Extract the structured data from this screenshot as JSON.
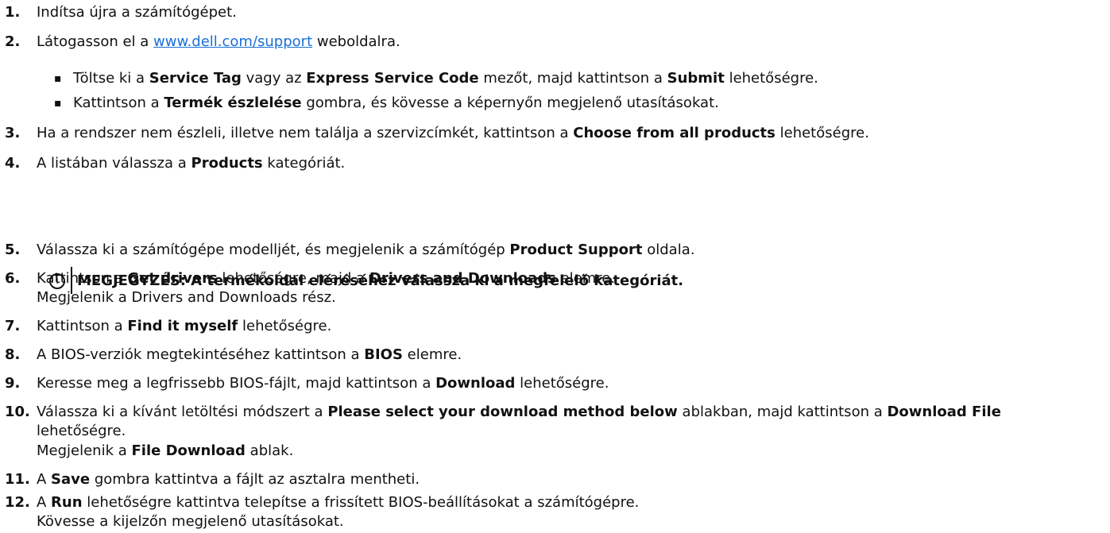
{
  "steps": {
    "s1": {
      "num": "1.",
      "text": "Indítsa újra a számítógépet."
    },
    "s2": {
      "num": "2.",
      "pre": "Látogasson el a ",
      "link": "www.dell.com/support",
      "post": " weboldalra."
    },
    "b1": {
      "bullet": "▪",
      "a": "Töltse ki a ",
      "b1": "Service Tag",
      "c": " vagy az ",
      "b2": "Express Service Code",
      "d": " mezőt, majd kattintson a ",
      "b3": "Submit",
      "e": " lehetőségre."
    },
    "b2": {
      "bullet": "▪",
      "a": "Kattintson a ",
      "b1": "Termék észlelése",
      "c": " gombra, és kövesse a képernyőn megjelenő utasításokat."
    },
    "s3": {
      "num": "3.",
      "a": "Ha a rendszer nem észleli, illetve nem találja a szervizcímkét, kattintson a ",
      "b1": "Choose from all products",
      "c": " lehetőségre."
    },
    "s4": {
      "num": "4.",
      "a": "A listában válassza a ",
      "b1": "Products",
      "c": " kategóriát."
    },
    "note": {
      "icon": "i",
      "text": "MEGJEGYZÉS: A termékoldal eléréséhez válassza ki a megfelelő kategóriát."
    },
    "s5": {
      "num": "5.",
      "a": "Válassza ki a számítógépe modelljét, és megjelenik a számítógép ",
      "b1": "Product Support",
      "c": " oldala."
    },
    "s6": {
      "num": "6.",
      "a": "Kattintson a ",
      "b1": "Get drivers",
      "c": " lehetőségre, majd a ",
      "b2": "Drivers and Downloads",
      "d": " elemre.",
      "line2": "Megjelenik a Drivers and Downloads rész."
    },
    "s7": {
      "num": "7.",
      "a": "Kattintson a ",
      "b1": "Find it myself",
      "c": " lehetőségre."
    },
    "s8": {
      "num": "8.",
      "a": "A BIOS-verziók megtekintéséhez kattintson a ",
      "b1": "BIOS",
      "c": " elemre."
    },
    "s9": {
      "num": "9.",
      "a": "Keresse meg a legfrissebb BIOS-fájlt, majd kattintson a ",
      "b1": "Download",
      "c": " lehetőségre."
    },
    "s10": {
      "num": "10.",
      "a": "Válassza ki a kívánt letöltési módszert a ",
      "b1": "Please select your download method below",
      "c": " ablakban, majd kattintson a ",
      "b2": "Download File",
      "line2": "lehetőségre.",
      "line3a": "Megjelenik a ",
      "line3b": "File Download",
      "line3c": " ablak."
    },
    "s11": {
      "num": "11.",
      "a": "A ",
      "b1": "Save",
      "c": " gombra kattintva a fájlt az asztalra mentheti."
    },
    "s12": {
      "num": "12.",
      "a": "A ",
      "b1": "Run",
      "c": " lehetőségre kattintva telepítse a frissített BIOS-beállításokat a számítógépre.",
      "line2": "Kövesse a kijelzőn megjelenő utasításokat."
    }
  }
}
